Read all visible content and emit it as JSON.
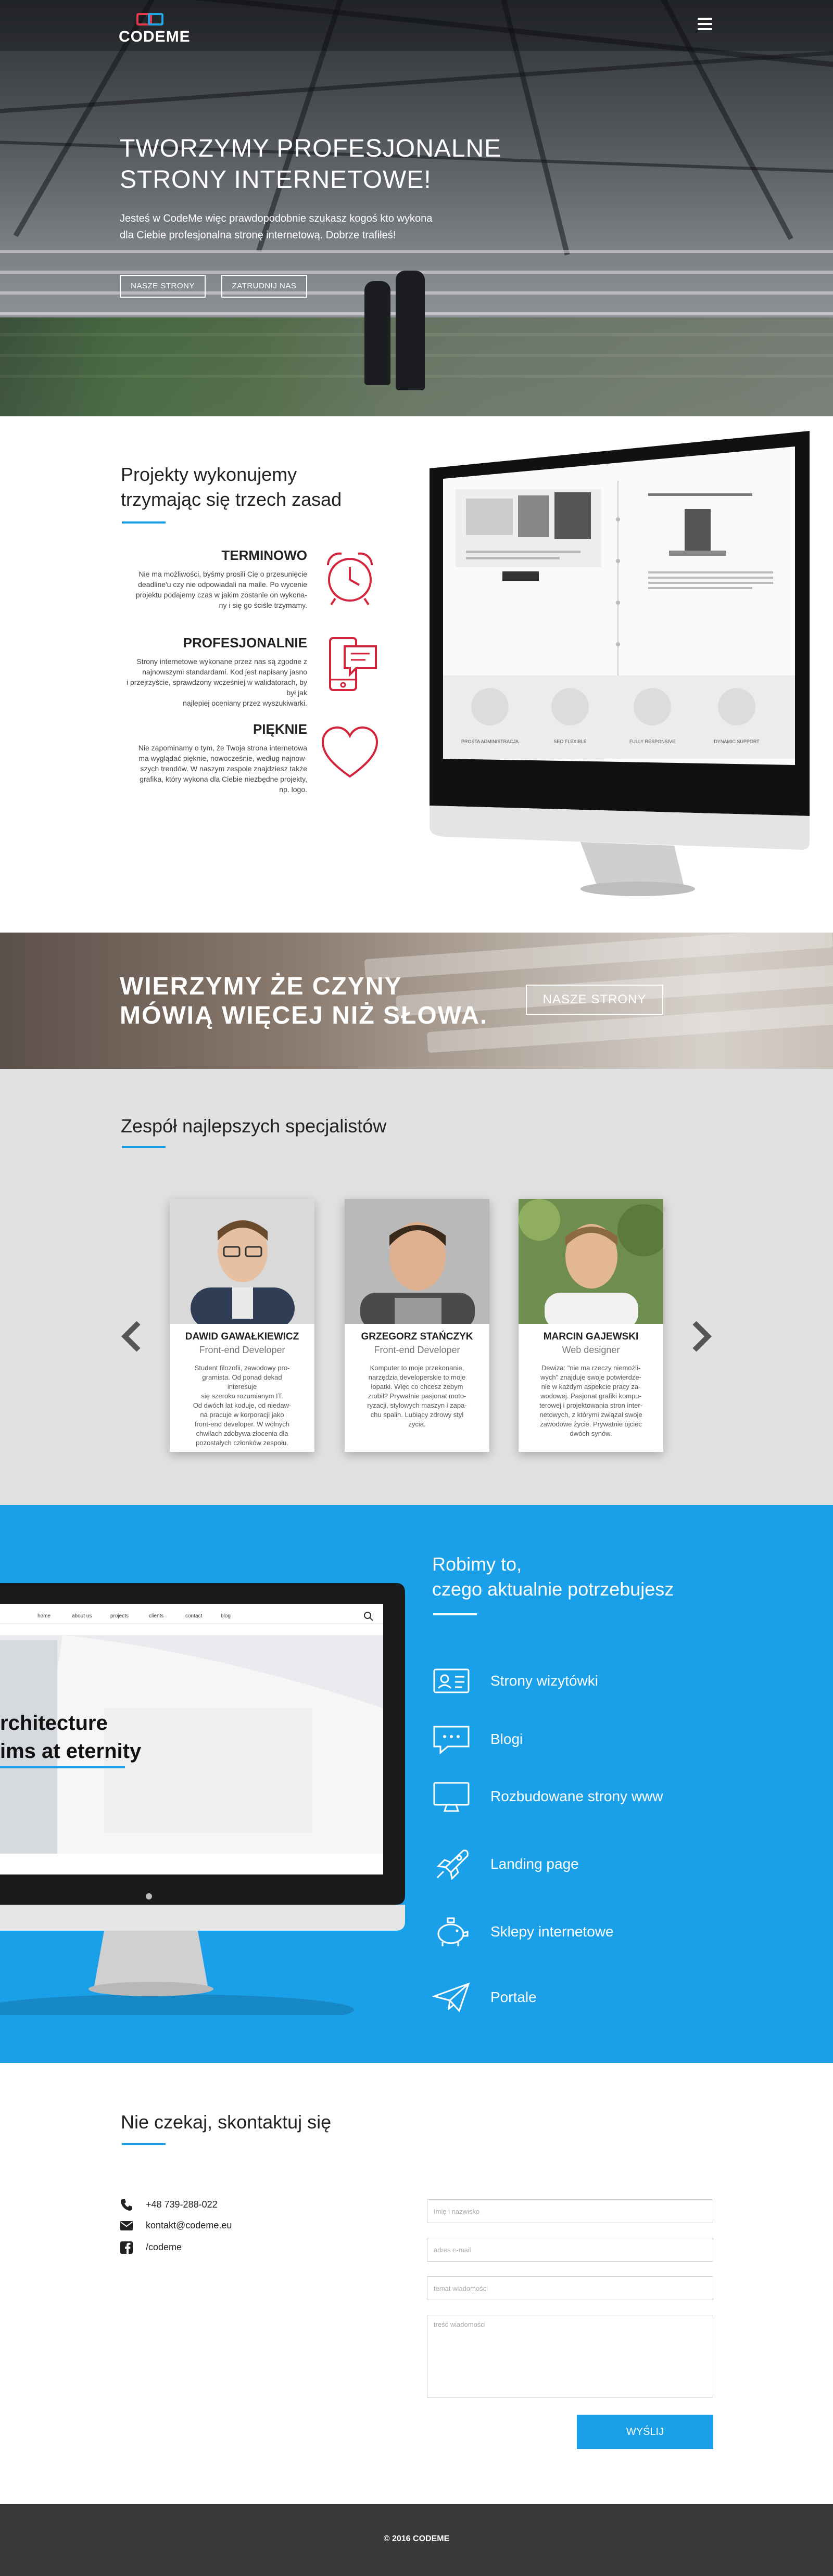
{
  "header": {
    "logo_text_code": "CODE",
    "logo_text_me": "ME",
    "menu_icon": "hamburger-menu-icon"
  },
  "hero": {
    "title_line1": "TWORZYMY PROFESJONALNE",
    "title_line2": "STRONY INTERNETOWE!",
    "subtitle_line1": "Jesteś w CodeMe więc prawdopodobnie szukasz kogoś kto wykona",
    "subtitle_line2": "dla Ciebie profesjonalna stronę internetową. Dobrze trafiłeś!",
    "btn_sites": "NASZE STRONY",
    "btn_hire": "ZATRUDNIJ NAS"
  },
  "principles": {
    "title_line1": "Projekty wykonujemy",
    "title_line2": "trzymając się trzech zasad",
    "items": [
      {
        "title": "TERMINOWO",
        "text_lines": [
          "Nie ma możliwości, byśmy prosili Cię o przesunięcie",
          "deadline'u czy nie odpowiadali na maile. Po wycenie",
          "projektu podajemy czas w jakim zostanie on wykona-",
          "ny i się go ściśle trzymamy."
        ],
        "icon": "alarm-clock-icon"
      },
      {
        "title": "PROFESJONALNIE",
        "text_lines": [
          "Strony internetowe wykonane przez nas są zgodne z",
          "najnowszymi standardami. Kod jest napisany jasno",
          "i przejrzyście, sprawdzony wcześniej w walidatorach, by był jak",
          "najlepiej oceniany przez wyszukiwarki."
        ],
        "icon": "mobile-chat-icon"
      },
      {
        "title": "PIĘKNIE",
        "text_lines": [
          "Nie zapominamy o tym, że Twoja strona internetowa",
          "ma wyglądać pięknie, nowocześnie, według najnow-",
          "szych trendów. W naszym zespole znajdziesz także",
          "grafika, który wykona dla Ciebie niezbędne projekty,",
          "np. logo."
        ],
        "icon": "heart-icon"
      }
    ],
    "monitor_features": [
      "PROSTA ADMINISTRACJA",
      "SEO FLEXIBLE",
      "FULLY RESPONSIVE",
      "DYNAMIC SUPPORT"
    ]
  },
  "banner": {
    "line1": "WIERZYMY ŻE CZYNY",
    "line2": "MÓWIĄ WIĘCEJ NIŻ SŁOWA.",
    "button": "NASZE STRONY"
  },
  "team": {
    "title": "Zespół najlepszych specjalistów",
    "members": [
      {
        "name": "DAWID GAWAŁKIEWICZ",
        "role": "Front-end Developer",
        "bio_lines": [
          "Student filozofii, zawodowy pro-",
          "gramista. Od ponad dekad interesuje",
          "się szeroko rozumianym IT.",
          "Od dwóch lat koduje, od niedaw-",
          "na pracuje w korporacji jako",
          "front-end developer. W wolnych",
          "chwilach zdobywa złocenia dla",
          "pozostałych członków zespołu."
        ]
      },
      {
        "name": "GRZEGORZ STAŃCZYK",
        "role": "Front-end Developer",
        "bio_lines": [
          "Komputer to moje przekonanie,",
          "narzędzia developerskie to moje",
          "łopatki. Więc co chcesz żebym",
          "zrobił? Prywatnie pasjonat moto-",
          "ryzacji, stylowych maszyn i zapa-",
          "chu spalin. Lubiący zdrowy styl",
          "życia."
        ]
      },
      {
        "name": "MARCIN GAJEWSKI",
        "role": "Web designer",
        "bio_lines": [
          "Dewiza: \"nie ma rzeczy niemożli-",
          "wych\" znajduje swoje potwierdze-",
          "nie w każdym aspekcie pracy za-",
          "wodowej. Pasjonat grafiki kompu-",
          "terowej i projektowania stron inter-",
          "netowych, z którymi związał swoje",
          "zawodowe życie. Prywatnie ojciec",
          "dwóch synów."
        ]
      }
    ]
  },
  "services": {
    "title_line1": "Robimy to,",
    "title_line2": "czego aktualnie potrzebujesz",
    "items": [
      {
        "label": "Strony wizytówki",
        "icon": "id-card-icon"
      },
      {
        "label": "Blogi",
        "icon": "chat-bubble-icon"
      },
      {
        "label": "Rozbudowane strony www",
        "icon": "monitor-icon"
      },
      {
        "label": "Landing page",
        "icon": "rocket-icon"
      },
      {
        "label": "Sklepy internetowe",
        "icon": "piggy-bank-icon"
      },
      {
        "label": "Portale",
        "icon": "paper-plane-icon"
      }
    ],
    "imac_nav": [
      "home",
      "about us",
      "projects",
      "clients",
      "contact",
      "blog"
    ],
    "imac_headline_line1": "rchitecture",
    "imac_headline_line2": "ims at eternity"
  },
  "contact": {
    "title": "Nie czekaj, skontaktuj się",
    "phone": "+48 739-288-022",
    "email": "kontakt@codeme.eu",
    "facebook": "/codeme",
    "placeholder_name": "Imię i nazwisko",
    "placeholder_email": "adres e-mail",
    "placeholder_subject": "temat wiadomości",
    "placeholder_message": "treść wiadomości",
    "send": "WYŚLIJ"
  },
  "footer": {
    "copyright": "© 2016 CODEME"
  }
}
